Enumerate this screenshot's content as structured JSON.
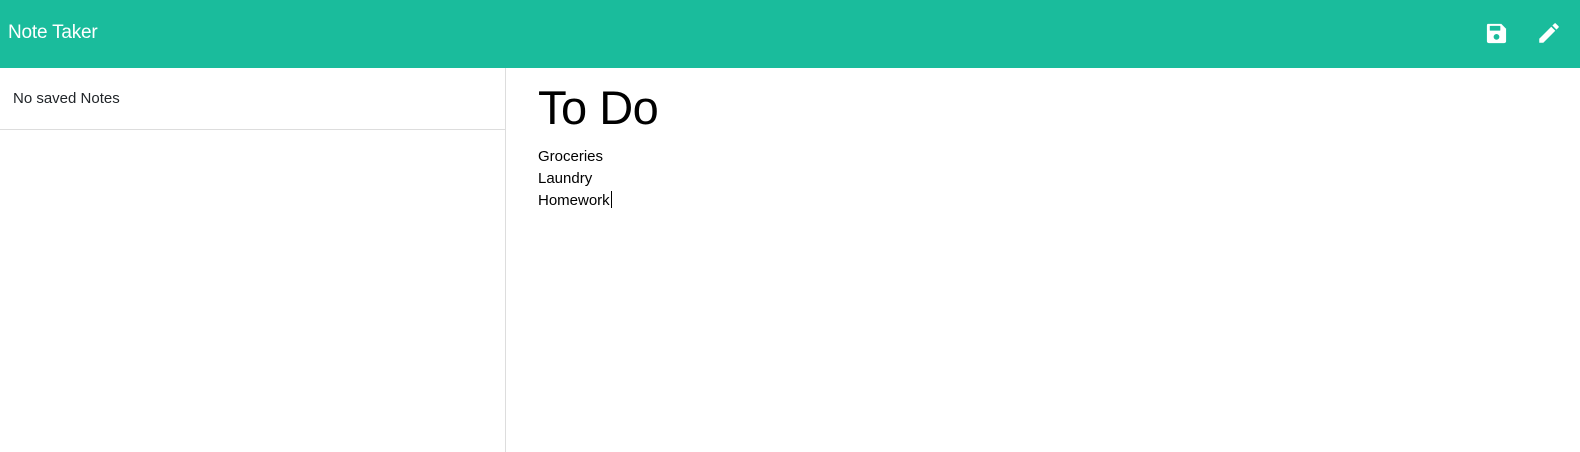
{
  "navbar": {
    "brand": "Note Taker",
    "background": "#1abc9c",
    "icons": [
      "save-icon",
      "pencil-icon"
    ]
  },
  "sidebar": {
    "empty_message": "No saved Notes"
  },
  "editor": {
    "title": "To Do",
    "body_lines": [
      "Groceries",
      "Laundry",
      "Homework"
    ]
  }
}
